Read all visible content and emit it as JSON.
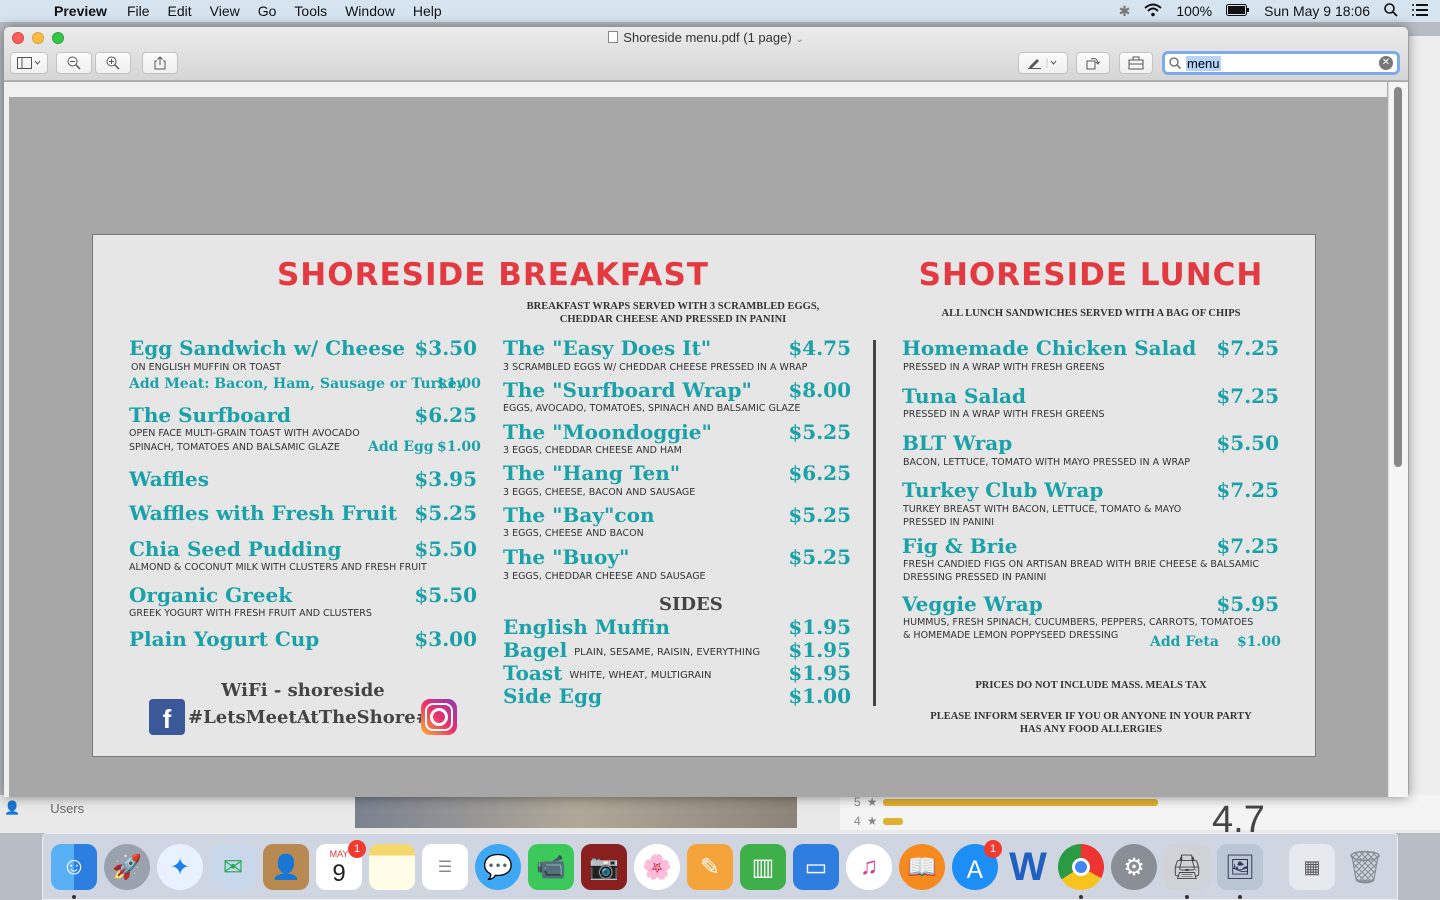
{
  "menubar": {
    "apple": "",
    "app_name": "Preview",
    "items": [
      "File",
      "Edit",
      "View",
      "Go",
      "Tools",
      "Window",
      "Help"
    ],
    "battery": "100%",
    "clock": "Sun May 9  18:06"
  },
  "window": {
    "title": "Shoreside menu.pdf (1 page)",
    "search_value": "menu"
  },
  "background": {
    "users_label": "Users",
    "ratings": [
      "5",
      "4"
    ],
    "rating_big": "4.7"
  },
  "menu": {
    "breakfast": {
      "title": "SHORESIDE BREAKFAST",
      "subtitle_1": "BREAKFAST WRAPS SERVED WITH 3 SCRAMBLED EGGS,",
      "subtitle_2": "CHEDDAR CHEESE AND PRESSED IN PANINI",
      "left_items": [
        {
          "name": "Egg Sandwich w/ Cheese",
          "price": "$3.50",
          "desc": "ON ENGLISH MUFFIN OR TOAST"
        },
        {
          "name": "The Surfboard",
          "price": "$6.25",
          "desc1": "OPEN FACE MULTI-GRAIN TOAST WITH AVOCADO",
          "desc2": "SPINACH, TOMATOES AND BALSAMIC GLAZE"
        },
        {
          "name": "Waffles",
          "price": "$3.95"
        },
        {
          "name": "Waffles with Fresh Fruit",
          "price": "$5.25"
        },
        {
          "name": "Chia Seed Pudding",
          "price": "$5.50",
          "desc": "ALMOND & COCONUT MILK WITH CLUSTERS AND FRESH FRUIT"
        },
        {
          "name": "Organic Greek",
          "price": "$5.50",
          "desc": "GREEK YOGURT WITH FRESH FRUIT AND CLUSTERS"
        },
        {
          "name": "Plain Yogurt Cup",
          "price": "$3.00"
        }
      ],
      "add_meat": {
        "label": "Add Meat: Bacon, Ham, Sausage or Turkey",
        "price": "$1.00"
      },
      "add_egg": {
        "label": "Add Egg",
        "price": "$1.00"
      },
      "wraps": [
        {
          "name": "The \"Easy Does It\"",
          "price": "$4.75",
          "desc": "3 SCRAMBLED EGGS W/ CHEDDAR CHEESE PRESSED IN A WRAP"
        },
        {
          "name": "The \"Surfboard Wrap\"",
          "price": "$8.00",
          "desc": "EGGS, AVOCADO, TOMATOES, SPINACH AND BALSAMIC GLAZE"
        },
        {
          "name": "The \"Moondoggie\"",
          "price": "$5.25",
          "desc": "3 EGGS, CHEDDAR CHEESE AND HAM"
        },
        {
          "name": "The \"Hang Ten\"",
          "price": "$6.25",
          "desc": "3 EGGS, CHEESE, BACON AND SAUSAGE"
        },
        {
          "name": "The \"Bay\"con",
          "price": "$5.25",
          "desc": "3 EGGS, CHEESE AND BACON"
        },
        {
          "name": "The \"Buoy\"",
          "price": "$5.25",
          "desc": "3 EGGS, CHEDDAR CHEESE AND SAUSAGE"
        }
      ],
      "sides_heading": "SIDES",
      "sides": [
        {
          "name": "English Muffin",
          "inline": "",
          "price": "$1.95"
        },
        {
          "name": "Bagel",
          "inline": "PLAIN, SESAME, RAISIN, EVERYTHING",
          "price": "$1.95"
        },
        {
          "name": "Toast",
          "inline": "WHITE, WHEAT, MULTIGRAIN",
          "price": "$1.95"
        },
        {
          "name": "Side Egg",
          "inline": "",
          "price": "$1.00"
        }
      ],
      "wifi": "WiFi - shoreside",
      "hashtag": "#LetsMeetAtTheShore#"
    },
    "lunch": {
      "title": "SHORESIDE LUNCH",
      "subtitle": "ALL LUNCH SANDWICHES SERVED WITH A BAG OF CHIPS",
      "items": [
        {
          "name": "Homemade Chicken Salad",
          "price": "$7.25",
          "desc1": "PRESSED IN A WRAP WITH FRESH GREENS",
          "desc2": ""
        },
        {
          "name": "Tuna Salad",
          "price": "$7.25",
          "desc1": "PRESSED IN A WRAP WITH FRESH GREENS",
          "desc2": ""
        },
        {
          "name": "BLT Wrap",
          "price": "$5.50",
          "desc1": "BACON, LETTUCE, TOMATO WITH MAYO PRESSED IN A WRAP",
          "desc2": ""
        },
        {
          "name": "Turkey Club Wrap",
          "price": "$7.25",
          "desc1": "TURKEY BREAST WITH BACON, LETTUCE, TOMATO & MAYO",
          "desc2": "PRESSED IN PANINI"
        },
        {
          "name": "Fig & Brie",
          "price": "$7.25",
          "desc1": "FRESH CANDIED FIGS ON ARTISAN BREAD WITH BRIE CHEESE & BALSAMIC",
          "desc2": "DRESSING PRESSED IN PANINI"
        },
        {
          "name": "Veggie Wrap",
          "price": "$5.95",
          "desc1": "HUMMUS, FRESH SPINACH, CUCUMBERS, PEPPERS, CARROTS, TOMATOES",
          "desc2": "& HOMEMADE LEMON POPPYSEED DRESSING"
        }
      ],
      "add_feta": {
        "label": "Add Feta",
        "price": "$1.00"
      },
      "note_tax": "PRICES DO NOT INCLUDE MASS. MEALS TAX",
      "note_allergy_1": "PLEASE INFORM SERVER IF YOU OR ANYONE IN YOUR PARTY",
      "note_allergy_2": "HAS ANY FOOD ALLERGIES"
    }
  },
  "dock": {
    "calendar_month": "MAY",
    "calendar_day": "9",
    "calendar_badge": "1",
    "appstore_badge": "1",
    "word_letter": "W"
  }
}
